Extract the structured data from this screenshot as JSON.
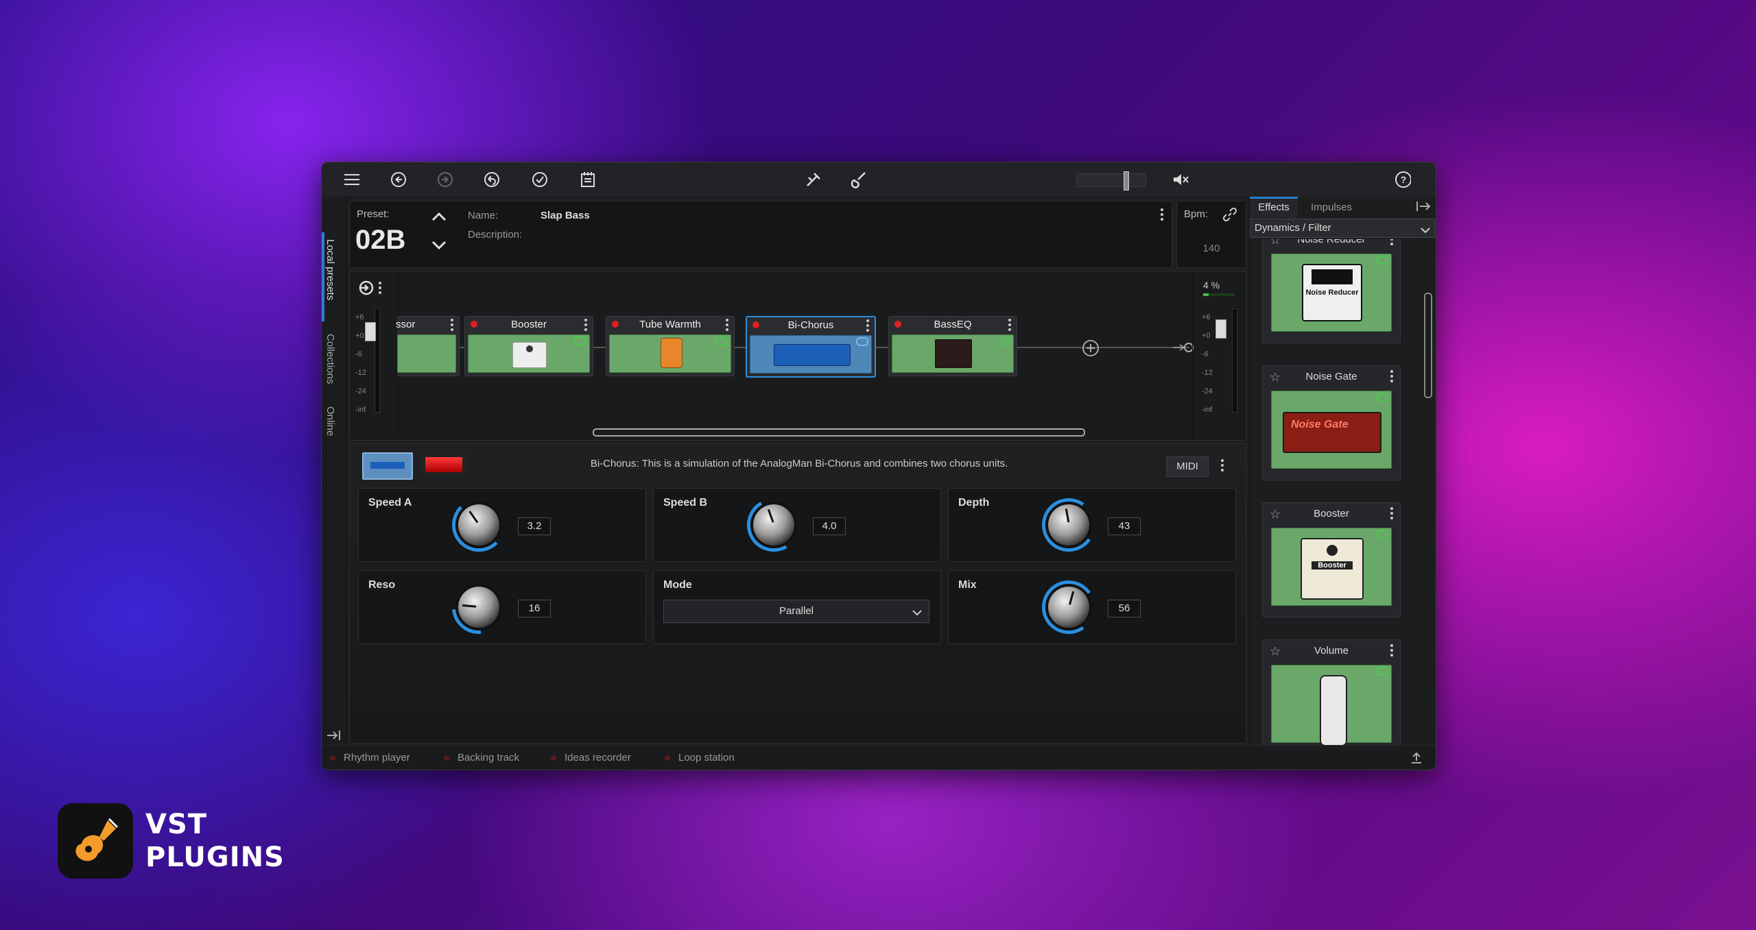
{
  "brand": {
    "line1": "VST",
    "line2": "PLUGINS"
  },
  "preset": {
    "label": "Preset:",
    "number": "02B",
    "name_label": "Name:",
    "name": "Slap Bass",
    "description_label": "Description:"
  },
  "bpm": {
    "label": "Bpm:",
    "value": "140"
  },
  "left_tabs": [
    "Local presets",
    "Collections",
    "Online"
  ],
  "chain": {
    "input_meter_ticks": [
      "+6",
      "+0",
      "-6",
      "-12",
      "-24",
      "-inf"
    ],
    "output_meter_ticks": [
      "+6",
      "+0",
      "-6",
      "-12",
      "-24",
      "-inf"
    ],
    "output_percent": "4 %",
    "pedals": [
      {
        "name": "ssor"
      },
      {
        "name": "Booster"
      },
      {
        "name": "Tube Warmth"
      },
      {
        "name": "Bi-Chorus"
      },
      {
        "name": "BassEQ"
      }
    ]
  },
  "editor": {
    "description": "Bi-Chorus:  This is a simulation of the AnalogMan Bi-Chorus and combines two chorus units.",
    "midi_label": "MIDI",
    "params": [
      {
        "name": "Speed A",
        "value": "3.2",
        "level": 0.32
      },
      {
        "name": "Speed B",
        "value": "4.0",
        "level": 0.4
      },
      {
        "name": "Depth",
        "value": "43",
        "level": 0.43
      },
      {
        "name": "Reso",
        "value": "16",
        "level": 0.16
      },
      {
        "name": "Mode",
        "value": "Parallel"
      },
      {
        "name": "Mix",
        "value": "56",
        "level": 0.56
      }
    ]
  },
  "right_panel": {
    "tabs": [
      "Effects",
      "Impulses"
    ],
    "category": "Dynamics / Filter",
    "effects": [
      {
        "name": "Noise Reducer",
        "pedal_text": "Noise Reducer"
      },
      {
        "name": "Noise Gate",
        "pedal_text": "Noise Gate"
      },
      {
        "name": "Booster",
        "pedal_text": "Booster"
      },
      {
        "name": "Volume"
      }
    ]
  },
  "bottom": {
    "items": [
      "Rhythm player",
      "Backing track",
      "Ideas recorder",
      "Loop station"
    ]
  },
  "colors": {
    "accent": "#2a7fd0",
    "pedal_green": "#6aa86a",
    "led_red": "#e02020"
  }
}
